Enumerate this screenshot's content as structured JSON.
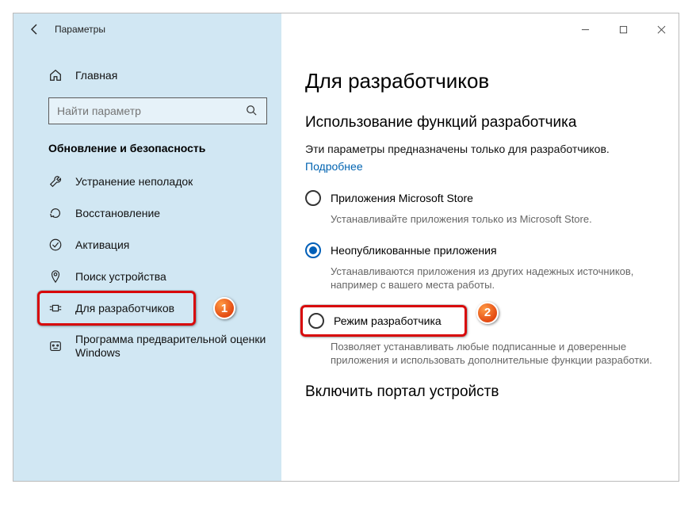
{
  "window": {
    "title": "Параметры"
  },
  "sidebar": {
    "home_label": "Главная",
    "search_placeholder": "Найти параметр",
    "category": "Обновление и безопасность",
    "items": [
      {
        "label": "Устранение неполадок"
      },
      {
        "label": "Восстановление"
      },
      {
        "label": "Активация"
      },
      {
        "label": "Поиск устройства"
      },
      {
        "label": "Для разработчиков"
      },
      {
        "label": "Программа предварительной оценки Windows"
      }
    ]
  },
  "page": {
    "title": "Для разработчиков",
    "section1": {
      "title": "Использование функций разработчика",
      "desc": "Эти параметры предназначены только для разработчиков.",
      "link": "Подробнее"
    },
    "radios": [
      {
        "label": "Приложения Microsoft Store",
        "desc": "Устанавливайте приложения только из Microsoft Store.",
        "selected": false
      },
      {
        "label": "Неопубликованные приложения",
        "desc": "Устанавливаются приложения из других надежных источников, например с вашего места работы.",
        "selected": true
      },
      {
        "label": "Режим разработчика",
        "desc": "Позволяет устанавливать любые подписанные и доверенные приложения и использовать дополнительные функции разработки.",
        "selected": false
      }
    ],
    "section2": {
      "title": "Включить портал устройств"
    }
  },
  "annotations": {
    "badge1": "1",
    "badge2": "2"
  }
}
